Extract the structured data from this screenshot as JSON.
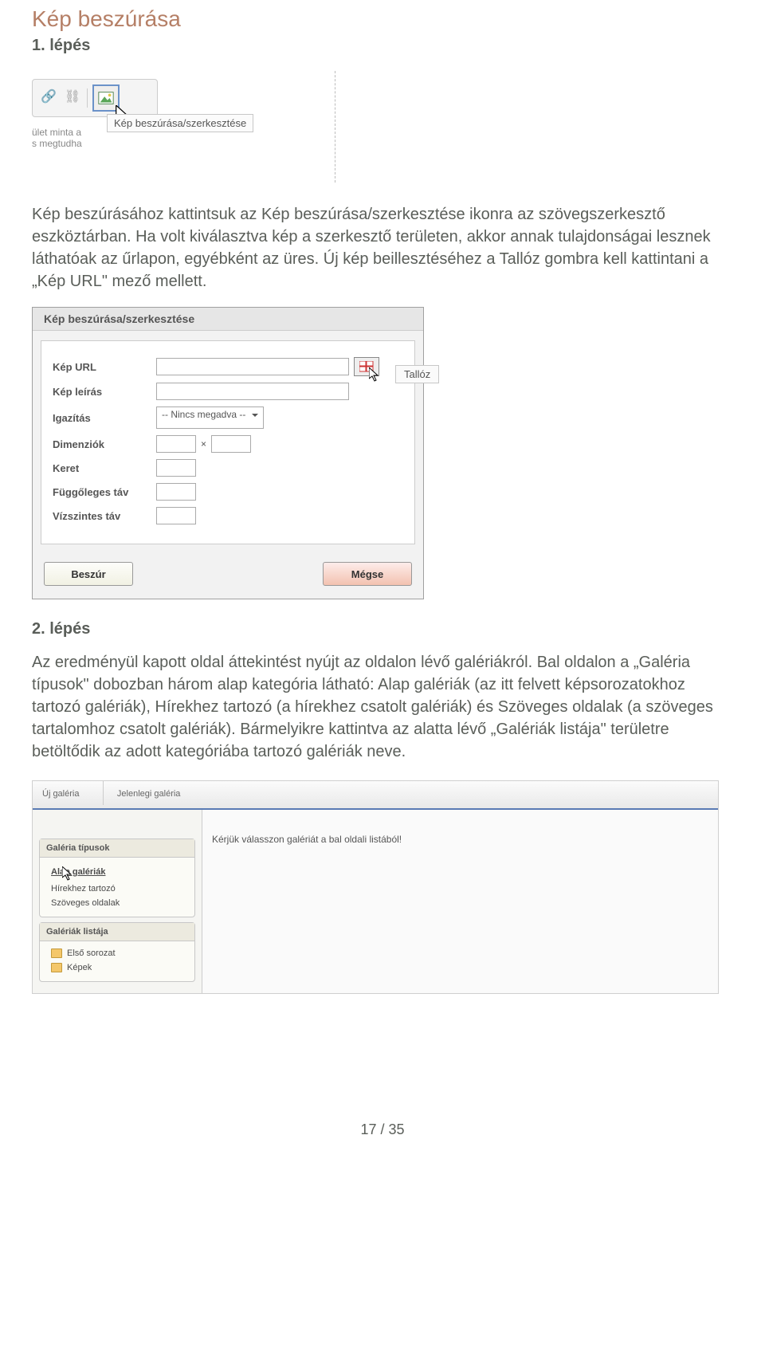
{
  "doc": {
    "title": "Kép beszúrása",
    "step1_title": "1. lépés",
    "step2_title": "2. lépés",
    "para1": "Kép beszúrásához kattintsuk az Kép beszúrása/szerkesztése ikonra az szövegszerkesztő eszköztárban. Ha volt kiválasztva kép a szerkesztő területen, akkor annak tulajdonságai lesznek láthatóak az űrlapon, egyébként az üres. Új kép beillesztéséhez a Tallóz gombra kell kattintani a „Kép URL\" mező mellett.",
    "para2": "Az eredményül kapott oldal áttekintést nyújt az oldalon lévő galériákról. Bal oldalon a „Galéria típusok\" dobozban három alap  kategória látható: Alap galériák (az itt felvett képsorozatokhoz tartozó galériák), Hírekhez tartozó (a hírekhez csatolt galériák) és Szöveges oldalak (a szöveges tartalomhoz csatolt galériák). Bármelyikre kattintva az alatta lévő „Galériák listája\" területre betöltődik az adott kategóriába tartozó galériák neve.",
    "page_number": "17 / 35"
  },
  "toolbar": {
    "tooltip": "Kép beszúrása/szerkesztése",
    "editor_text_1": "ület minta a",
    "editor_text_2": "s megtudha"
  },
  "dialog": {
    "title": "Kép beszúrása/szerkesztése",
    "labels": {
      "url": "Kép URL",
      "desc": "Kép leírás",
      "align": "Igazítás",
      "dims": "Dimenziók",
      "border": "Keret",
      "vspace": "Függőleges táv",
      "hspace": "Vízszintes táv"
    },
    "align_value": "-- Nincs megadva --",
    "talloz_tip": "Tallóz",
    "insert_btn": "Beszúr",
    "cancel_btn": "Mégse",
    "dims_x": "×"
  },
  "gallery": {
    "tab_new": "Új galéria",
    "tab_current": "Jelenlegi galéria",
    "panel_types_title": "Galéria típusok",
    "types": {
      "t0": "Alap galériák",
      "t1": "Hírekhez tartozó",
      "t2": "Szöveges oldalak"
    },
    "panel_list_title": "Galériák listája",
    "list": {
      "g0": "Első sorozat",
      "g1": "Képek"
    },
    "main_prompt": "Kérjük válasszon galériát a bal oldali listából!"
  }
}
